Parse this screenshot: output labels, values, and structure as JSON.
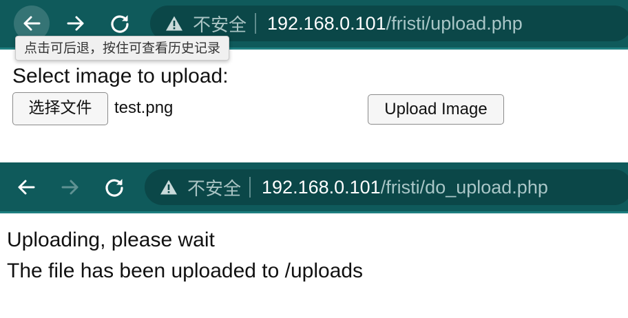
{
  "top_window": {
    "nav": {
      "back_icon": "arrow-left-icon",
      "forward_icon": "arrow-right-icon",
      "reload_icon": "reload-icon",
      "forward_enabled": true
    },
    "address_bar": {
      "security_icon": "warning-triangle-icon",
      "security_label": "不安全",
      "url_host": "192.168.0.101",
      "url_path": "/fristi/upload.php"
    },
    "tooltip": "点击可后退，按住可查看历史记录",
    "page": {
      "prompt": "Select image to upload:",
      "file_button_label": "选择文件",
      "file_name": "test.png",
      "submit_label": "Upload Image"
    }
  },
  "bottom_window": {
    "nav": {
      "back_icon": "arrow-left-icon",
      "forward_icon": "arrow-right-icon",
      "reload_icon": "reload-icon",
      "forward_enabled": false
    },
    "address_bar": {
      "security_icon": "warning-triangle-icon",
      "security_label": "不安全",
      "url_host": "192.168.0.101",
      "url_path": "/fristi/do_upload.php"
    },
    "page": {
      "lines": [
        "Uploading, please wait",
        "The file has been uploaded to /uploads"
      ]
    }
  },
  "colors": {
    "toolbar_bg": "#0f5a5b",
    "omnibox_bg": "#0b4748",
    "url_host": "#ffffff",
    "url_path": "#a9c6c7"
  }
}
